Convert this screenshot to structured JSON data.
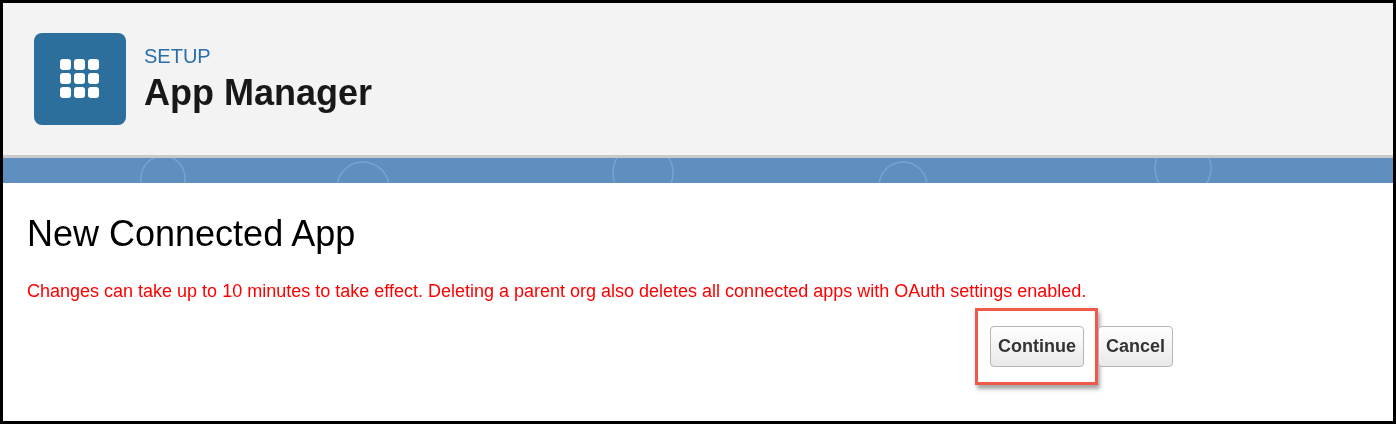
{
  "header": {
    "eyebrow": "SETUP",
    "title": "App Manager"
  },
  "page": {
    "title": "New Connected App",
    "message": "Changes can take up to 10 minutes to take effect. Deleting a parent org also deletes all connected apps with OAuth settings enabled."
  },
  "buttons": [
    {
      "label": "Continue",
      "highlighted": true
    },
    {
      "label": "Cancel",
      "highlighted": false
    }
  ]
}
